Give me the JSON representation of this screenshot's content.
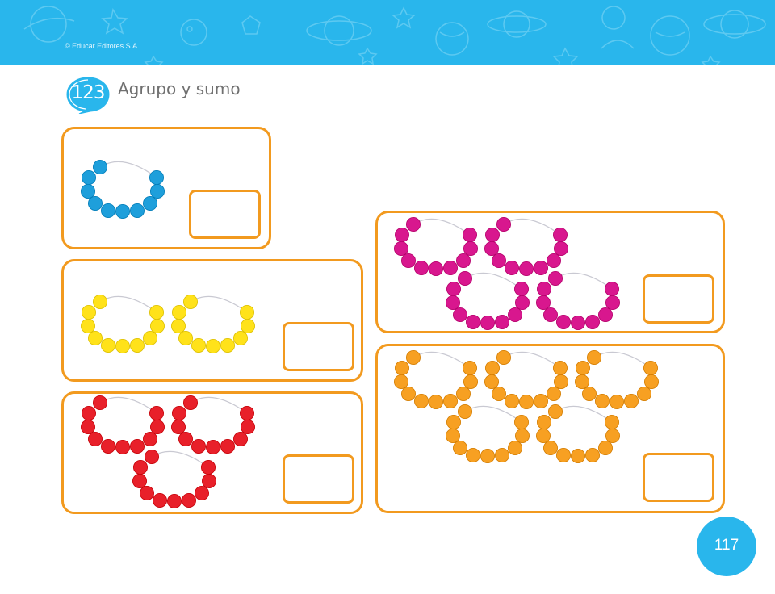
{
  "header": {
    "copyright": "© Educar Editores S.A.",
    "background_color": "#29b6ec"
  },
  "activity": {
    "number": "123",
    "title": "Agrupo y sumo",
    "icon": "speech-bubble-icon"
  },
  "exercises": [
    {
      "id": "blue",
      "color": "#1e9fdb",
      "groups": 1,
      "beads_per_group": 10,
      "answer": ""
    },
    {
      "id": "yellow",
      "color": "#ffe21a",
      "groups": 2,
      "beads_per_group": 10,
      "answer": ""
    },
    {
      "id": "red",
      "color": "#e8202a",
      "groups": 3,
      "beads_per_group": 10,
      "answer": ""
    },
    {
      "id": "pink",
      "color": "#d8178e",
      "groups": 4,
      "beads_per_group": 10,
      "answer": ""
    },
    {
      "id": "orange",
      "color": "#f7a022",
      "groups": 5,
      "beads_per_group": 10,
      "answer": ""
    }
  ],
  "footer": {
    "page_number": "117"
  }
}
